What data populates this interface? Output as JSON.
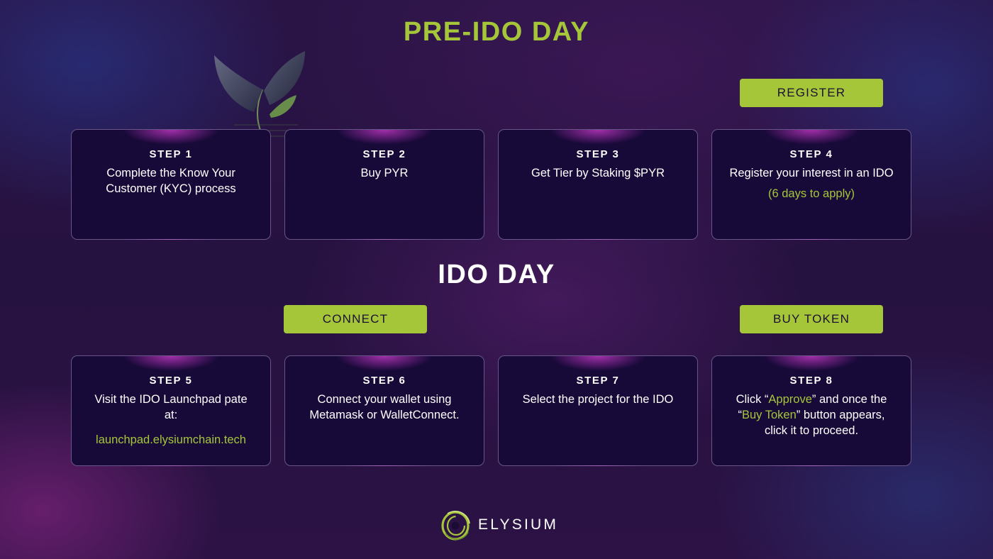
{
  "pre_ido": {
    "title": "PRE-IDO DAY",
    "register_button": "REGISTER",
    "steps": [
      {
        "label": "STEP 1",
        "text": "Complete the Know Your Customer (KYC) process"
      },
      {
        "label": "STEP 2",
        "text": "Buy PYR"
      },
      {
        "label": "STEP 3",
        "text": "Get Tier by Staking $PYR"
      },
      {
        "label": "STEP 4",
        "text": "Register your interest in an IDO",
        "note": "(6 days to apply)"
      }
    ]
  },
  "ido": {
    "title": "IDO DAY",
    "connect_button": "CONNECT",
    "buy_button": "BUY TOKEN",
    "steps": [
      {
        "label": "STEP 5",
        "text": "Visit the IDO Launchpad pate at:",
        "link": "launchpad.elysiumchain.tech"
      },
      {
        "label": "STEP 6",
        "text": "Connect your wallet using Metamask or WalletConnect."
      },
      {
        "label": "STEP 7",
        "text": "Select the project for the IDO"
      },
      {
        "label": "STEP 8",
        "parts": [
          "Click “",
          "Approve",
          "” and once the “",
          "Buy Token",
          "” button appears, click it to proceed."
        ]
      }
    ]
  },
  "logo": {
    "text": "ELYSIUM",
    "icon": "elysium-ring-icon"
  },
  "decoration": {
    "icon": "plant-leaves-icon"
  },
  "colors": {
    "accent": "#a6c63a",
    "card_bg": "#170938",
    "background": "#2a1446"
  }
}
